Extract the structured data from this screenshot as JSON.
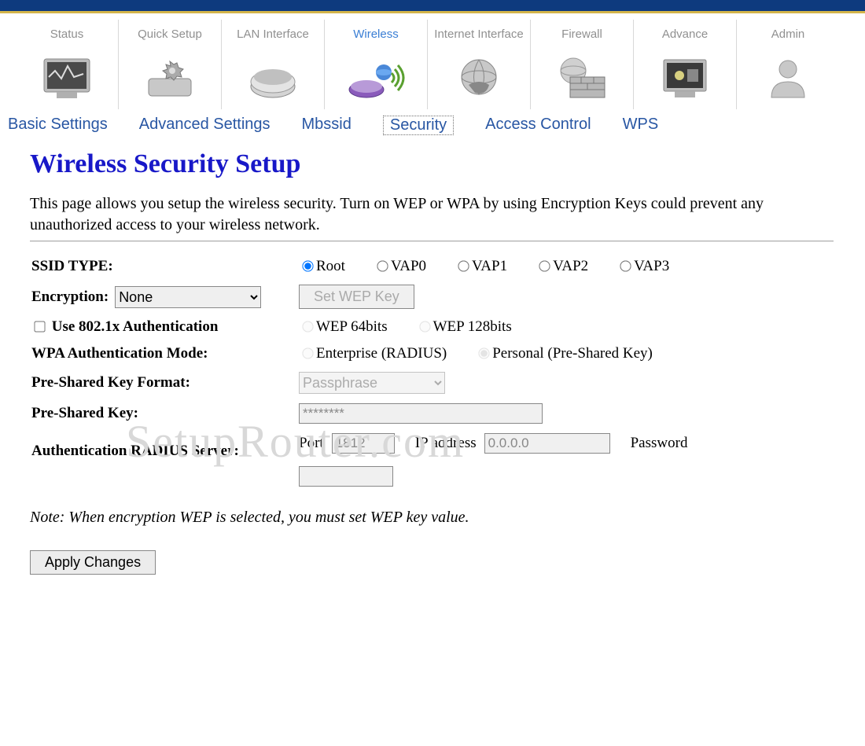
{
  "main_nav": [
    {
      "label": "Status",
      "active": false
    },
    {
      "label": "Quick Setup",
      "active": false
    },
    {
      "label": "LAN Interface",
      "active": false
    },
    {
      "label": "Wireless",
      "active": true
    },
    {
      "label": "Internet Interface",
      "active": false
    },
    {
      "label": "Firewall",
      "active": false
    },
    {
      "label": "Advance",
      "active": false
    },
    {
      "label": "Admin",
      "active": false
    }
  ],
  "sub_nav": {
    "basic": "Basic Settings",
    "advanced": "Advanced Settings",
    "mbssid": "Mbssid",
    "security": "Security",
    "access": "Access Control",
    "wps": "WPS"
  },
  "page": {
    "title": "Wireless Security Setup",
    "desc": "This page allows you setup the wireless security. Turn on WEP or WPA by using Encryption Keys could prevent any unauthorized access to your wireless network."
  },
  "form": {
    "ssid_type_label": "SSID TYPE:",
    "ssid_options": [
      "Root",
      "VAP0",
      "VAP1",
      "VAP2",
      "VAP3"
    ],
    "encryption_label": "Encryption:",
    "encryption_value": "None",
    "set_wep_btn": "Set WEP Key",
    "use_8021x_label": "Use 802.1x Authentication",
    "wep64_label": "WEP 64bits",
    "wep128_label": "WEP 128bits",
    "wpa_mode_label": "WPA Authentication Mode:",
    "wpa_enterprise": "Enterprise (RADIUS)",
    "wpa_personal": "Personal (Pre-Shared Key)",
    "psk_format_label": "Pre-Shared Key Format:",
    "psk_format_value": "Passphrase",
    "psk_label": "Pre-Shared Key:",
    "psk_value": "********",
    "radius_label": "Authentication RADIUS Server:",
    "port_label": "Port",
    "port_value": "1812",
    "ip_label": "IP address",
    "ip_value": "0.0.0.0",
    "password_label": "Password",
    "password_value": ""
  },
  "note": "Note: When encryption WEP is selected, you must set WEP key value.",
  "apply_btn": "Apply Changes",
  "watermark": "SetupRouter.com"
}
